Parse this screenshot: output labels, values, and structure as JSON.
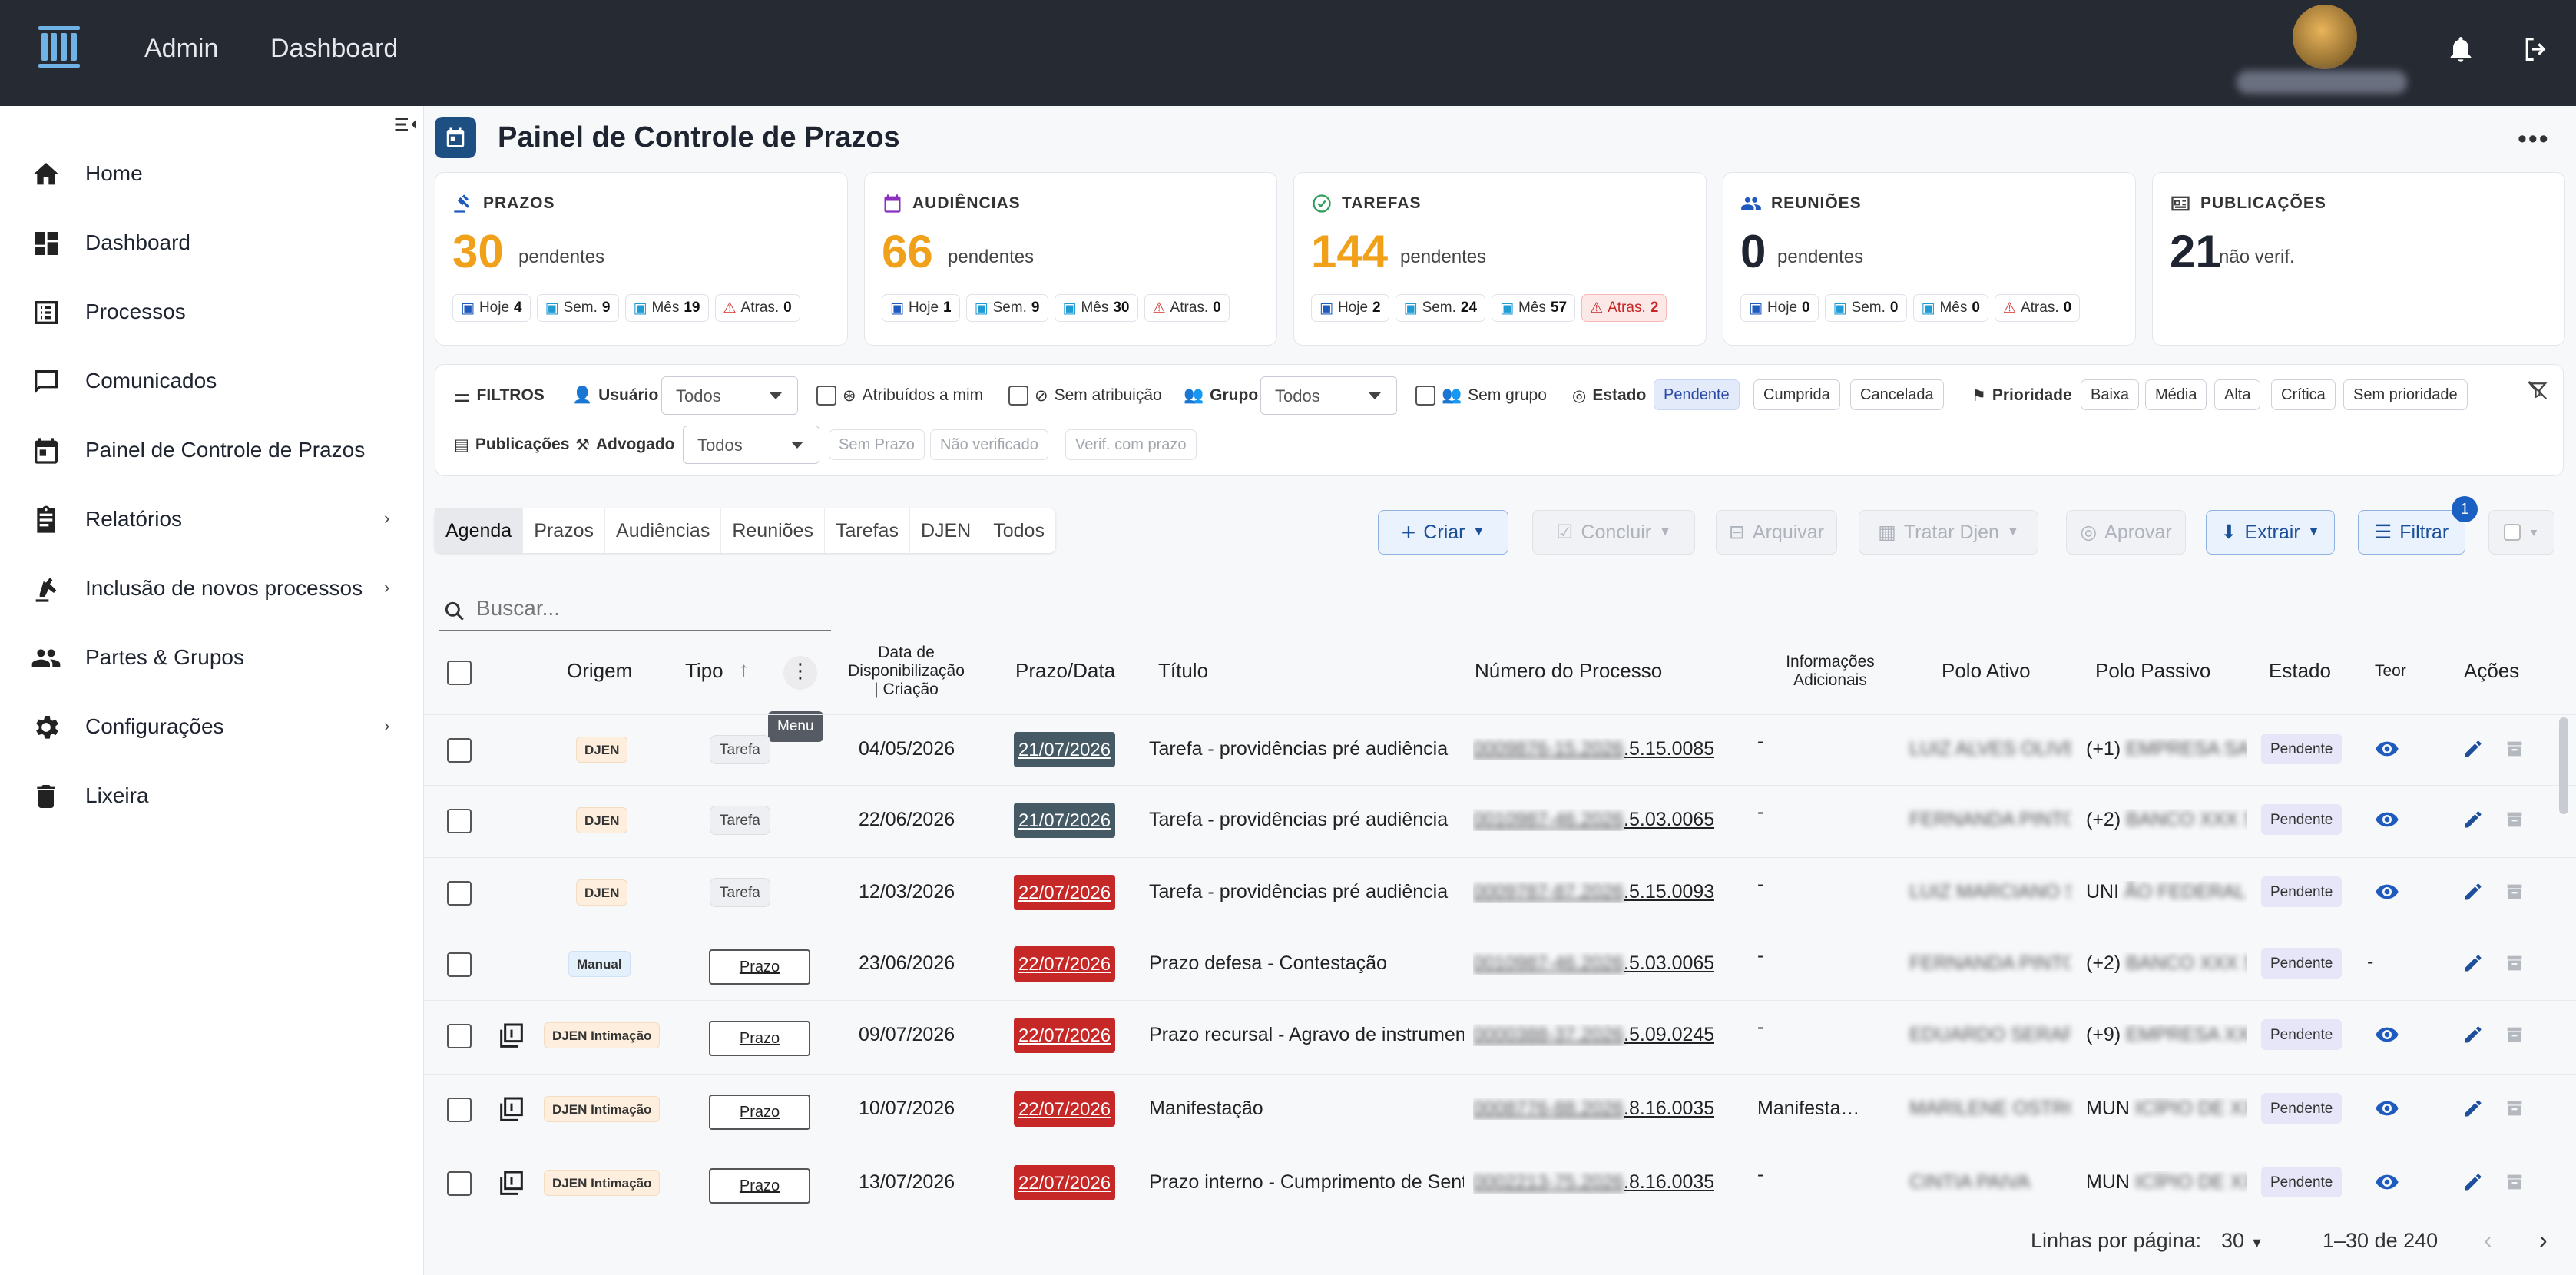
{
  "topbar": {
    "nav": [
      "Admin",
      "Dashboard"
    ]
  },
  "sidebar": {
    "items": [
      {
        "label": "Home",
        "icon": "home-icon"
      },
      {
        "label": "Dashboard",
        "icon": "dashboard-icon"
      },
      {
        "label": "Processos",
        "icon": "list-icon"
      },
      {
        "label": "Comunicados",
        "icon": "chat-icon"
      },
      {
        "label": "Painel de Controle de Prazos",
        "icon": "calendar-icon"
      },
      {
        "label": "Relatórios",
        "icon": "clipboard-icon",
        "arrow": "›"
      },
      {
        "label": "Inclusão de novos processos",
        "icon": "robot-arm-icon",
        "arrow": "›"
      },
      {
        "label": "Partes & Grupos",
        "icon": "people-icon"
      },
      {
        "label": "Configurações",
        "icon": "gear-icon",
        "arrow": "›"
      },
      {
        "label": "Lixeira",
        "icon": "trash-icon"
      }
    ]
  },
  "page": {
    "title": "Painel de Controle de Prazos"
  },
  "cards": [
    {
      "title": "PRAZOS",
      "value": "30",
      "sub": "pendentes",
      "color": "#f0a019",
      "chips": [
        {
          "l": "Hoje",
          "v": "4"
        },
        {
          "l": "Sem.",
          "v": "9"
        },
        {
          "l": "Mês",
          "v": "19"
        },
        {
          "l": "Atras.",
          "v": "0"
        }
      ]
    },
    {
      "title": "AUDIÊNCIAS",
      "value": "66",
      "sub": "pendentes",
      "color": "#f0a019",
      "chips": [
        {
          "l": "Hoje",
          "v": "1"
        },
        {
          "l": "Sem.",
          "v": "9"
        },
        {
          "l": "Mês",
          "v": "30"
        },
        {
          "l": "Atras.",
          "v": "0"
        }
      ]
    },
    {
      "title": "TAREFAS",
      "value": "144",
      "sub": "pendentes",
      "color": "#f0a019",
      "chips": [
        {
          "l": "Hoje",
          "v": "2"
        },
        {
          "l": "Sem.",
          "v": "24"
        },
        {
          "l": "Mês",
          "v": "57"
        },
        {
          "l": "Atras.",
          "v": "2"
        }
      ]
    },
    {
      "title": "REUNIÕES",
      "value": "0",
      "sub": "pendentes",
      "color": "#1e2430",
      "chips": [
        {
          "l": "Hoje",
          "v": "0"
        },
        {
          "l": "Sem.",
          "v": "0"
        },
        {
          "l": "Mês",
          "v": "0"
        },
        {
          "l": "Atras.",
          "v": "0"
        }
      ]
    },
    {
      "title": "PUBLICAÇÕES",
      "value": "21",
      "sub": "não verif.",
      "color": "#1e2430",
      "chips": []
    }
  ],
  "filters": {
    "title": "FILTROS",
    "usuario_label": "Usuário",
    "usuario_value": "Todos",
    "atribuidos": "Atribuídos a mim",
    "sem_atribuicao": "Sem atribuição",
    "grupo_label": "Grupo",
    "grupo_value": "Todos",
    "sem_grupo": "Sem grupo",
    "estado_label": "Estado",
    "estados": [
      "Pendente",
      "Cumprida",
      "Cancelada"
    ],
    "prioridade_label": "Prioridade",
    "prioridades": [
      "Baixa",
      "Média",
      "Alta",
      "Crítica",
      "Sem prioridade"
    ],
    "publicacoes_label": "Publicações",
    "advogado_label": "Advogado",
    "advogado_value": "Todos",
    "pub_opts": [
      "Sem Prazo",
      "Não verificado",
      "Verif. com prazo"
    ]
  },
  "tabs": [
    "Agenda",
    "Prazos",
    "Audiências",
    "Reuniões",
    "Tarefas",
    "DJEN",
    "Todos"
  ],
  "toolbar": {
    "criar": "Criar",
    "concluir": "Concluir",
    "arquivar": "Arquivar",
    "tratar": "Tratar Djen",
    "aprovar": "Aprovar",
    "extrair": "Extrair",
    "filtrar": "Filtrar",
    "filter_badge": "1"
  },
  "search": {
    "placeholder": "Buscar..."
  },
  "table": {
    "headers": {
      "origem": "Origem",
      "tipo": "Tipo",
      "disp": [
        "Data de",
        "Disponibilização",
        "| Criação"
      ],
      "prazo": "Prazo/Data",
      "titulo": "Título",
      "numero": "Número do Processo",
      "info": [
        "Informações",
        "Adicionais"
      ],
      "polo_ativo": "Polo Ativo",
      "polo_passivo": "Polo Passivo",
      "estado": "Estado",
      "teor": "Teor",
      "acoes": "Ações"
    },
    "tooltip": "Menu",
    "rows": [
      {
        "origem": "DJEN",
        "tipo": "Tarefa",
        "data": "04/05/2026",
        "prazo": "21/07/2026",
        "prazo_color": "dark",
        "titulo": "Tarefa - providências pré audiência",
        "num_blur": "0009876-15.2026",
        "num_tail": ".5.15.0085",
        "info": "-",
        "ativo_blur": "LUIZ ALVES OLIVEIR",
        "passivo_pre": "(+1)",
        "passivo_blur": "EMPRESA SA LTDA",
        "estado": "Pendente",
        "teor": "eye",
        "copy": false
      },
      {
        "origem": "DJEN",
        "tipo": "Tarefa",
        "data": "22/06/2026",
        "prazo": "21/07/2026",
        "prazo_color": "dark",
        "titulo": "Tarefa - providências pré audiência",
        "num_blur": "0010987-46.2026",
        "num_tail": ".5.03.0065",
        "info": "-",
        "ativo_blur": "FERNANDA PINTO SIL",
        "passivo_pre": "(+2)",
        "passivo_blur": "BANCO XXX SA",
        "estado": "Pendente",
        "teor": "eye",
        "copy": false
      },
      {
        "origem": "DJEN",
        "tipo": "Tarefa",
        "data": "12/03/2026",
        "prazo": "22/07/2026",
        "prazo_color": "red",
        "titulo": "Tarefa - providências pré audiência",
        "num_blur": "0009787-87.2026",
        "num_tail": ".5.15.0093",
        "info": "-",
        "ativo_blur": "LUIZ MARCIANO SIL",
        "passivo_pre": "UNI",
        "passivo_blur": "ÃO FEDERAL BR",
        "estado": "Pendente",
        "teor": "eye",
        "copy": false
      },
      {
        "origem": "Manual",
        "tipo": "Prazo",
        "data": "23/06/2026",
        "prazo": "22/07/2026",
        "prazo_color": "red",
        "titulo": "Prazo defesa - Contestação",
        "num_blur": "0010987-46.2026",
        "num_tail": ".5.03.0065",
        "info": "-",
        "ativo_blur": "FERNANDA PINTO SIL",
        "passivo_pre": "(+2)",
        "passivo_blur": "BANCO XXX SA",
        "estado": "Pendente",
        "teor": "-",
        "copy": false
      },
      {
        "origem": "DJEN Intimação",
        "tipo": "Prazo",
        "data": "09/07/2026",
        "prazo": "22/07/2026",
        "prazo_color": "red",
        "titulo": "Prazo recursal - Agravo de instrumento",
        "num_blur": "0000388-37.2026",
        "num_tail": ".5.09.0245",
        "info": "-",
        "ativo_blur": "EDUARDO SERAFIM",
        "passivo_pre": "(+9)",
        "passivo_blur": "EMPRESA XXX SA",
        "estado": "Pendente",
        "teor": "eye",
        "copy": true
      },
      {
        "origem": "DJEN Intimação",
        "tipo": "Prazo",
        "data": "10/07/2026",
        "prazo": "22/07/2026",
        "prazo_color": "red",
        "titulo": "Manifestação",
        "num_blur": "0008776-88.2026",
        "num_tail": ".8.16.0035",
        "info": "Manifesta…",
        "ativo_blur": "MARILENE OSTRO",
        "passivo_pre": "MUN",
        "passivo_blur": "ICÍPIO DE XX",
        "estado": "Pendente",
        "teor": "eye",
        "copy": true
      },
      {
        "origem": "DJEN Intimação",
        "tipo": "Prazo",
        "data": "13/07/2026",
        "prazo": "22/07/2026",
        "prazo_color": "red",
        "titulo": "Prazo interno - Cumprimento de Sentença",
        "num_blur": "0002213-75.2026",
        "num_tail": ".8.16.0035",
        "info": "-",
        "ativo_blur": "CINTIA PAIVA",
        "passivo_pre": "MUN",
        "passivo_blur": "ICÍPIO DE XX",
        "estado": "Pendente",
        "teor": "eye",
        "copy": true
      }
    ]
  },
  "pagination": {
    "rows_label": "Linhas por página:",
    "rows_value": "30",
    "range": "1–30 de 240"
  }
}
